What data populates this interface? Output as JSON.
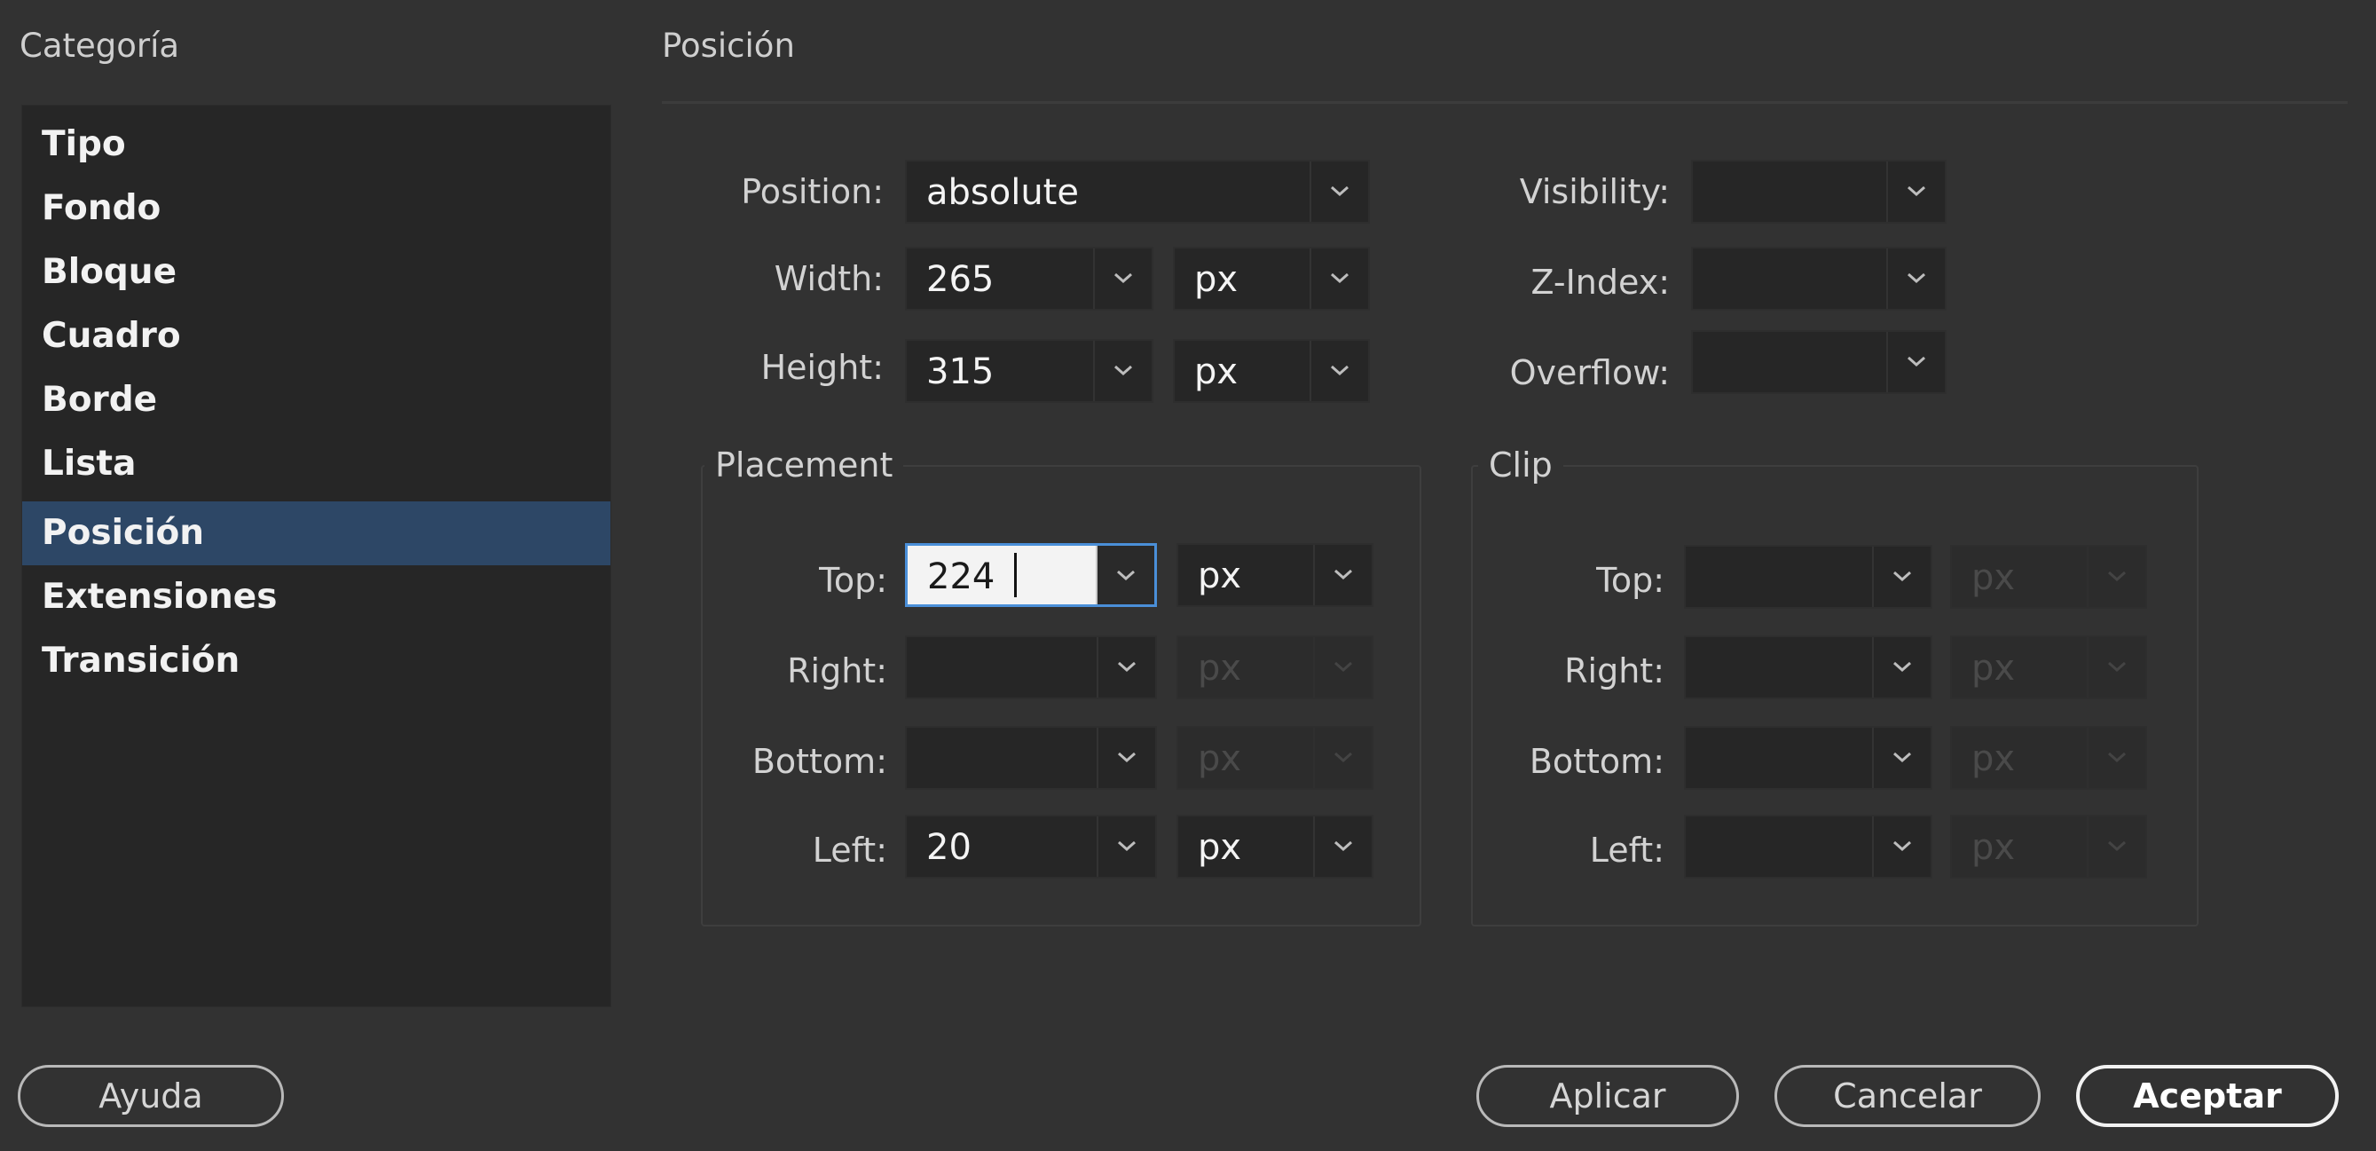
{
  "categories": {
    "title": "Categoría",
    "items": [
      "Tipo",
      "Fondo",
      "Bloque",
      "Cuadro",
      "Borde",
      "Lista",
      "Posición",
      "Extensiones",
      "Transición"
    ],
    "selected": "Posición"
  },
  "panel": {
    "title": "Posición",
    "position": {
      "label": "Position:",
      "value": "absolute"
    },
    "width": {
      "label": "Width:",
      "value": "265",
      "unit": "px"
    },
    "height": {
      "label": "Height:",
      "value": "315",
      "unit": "px"
    },
    "visibility": {
      "label": "Visibility:",
      "value": ""
    },
    "zindex": {
      "label": "Z-Index:",
      "value": ""
    },
    "overflow": {
      "label": "Overflow:",
      "value": ""
    }
  },
  "placement": {
    "title": "Placement",
    "top": {
      "label": "Top:",
      "value": "224",
      "unit": "px"
    },
    "right": {
      "label": "Right:",
      "value": "",
      "unit": "px"
    },
    "bottom": {
      "label": "Bottom:",
      "value": "",
      "unit": "px"
    },
    "left": {
      "label": "Left:",
      "value": "20",
      "unit": "px"
    }
  },
  "clip": {
    "title": "Clip",
    "top": {
      "label": "Top:",
      "value": "",
      "unit": "px"
    },
    "right": {
      "label": "Right:",
      "value": "",
      "unit": "px"
    },
    "bottom": {
      "label": "Bottom:",
      "value": "",
      "unit": "px"
    },
    "left": {
      "label": "Left:",
      "value": "",
      "unit": "px"
    }
  },
  "buttons": {
    "help": "Ayuda",
    "apply": "Aplicar",
    "cancel": "Cancelar",
    "ok": "Aceptar"
  },
  "icons": {
    "dropdown": "chevron-down-icon"
  },
  "colors": {
    "selection": "#2d4766",
    "focus": "#4a8fd8",
    "background": "#323232"
  }
}
